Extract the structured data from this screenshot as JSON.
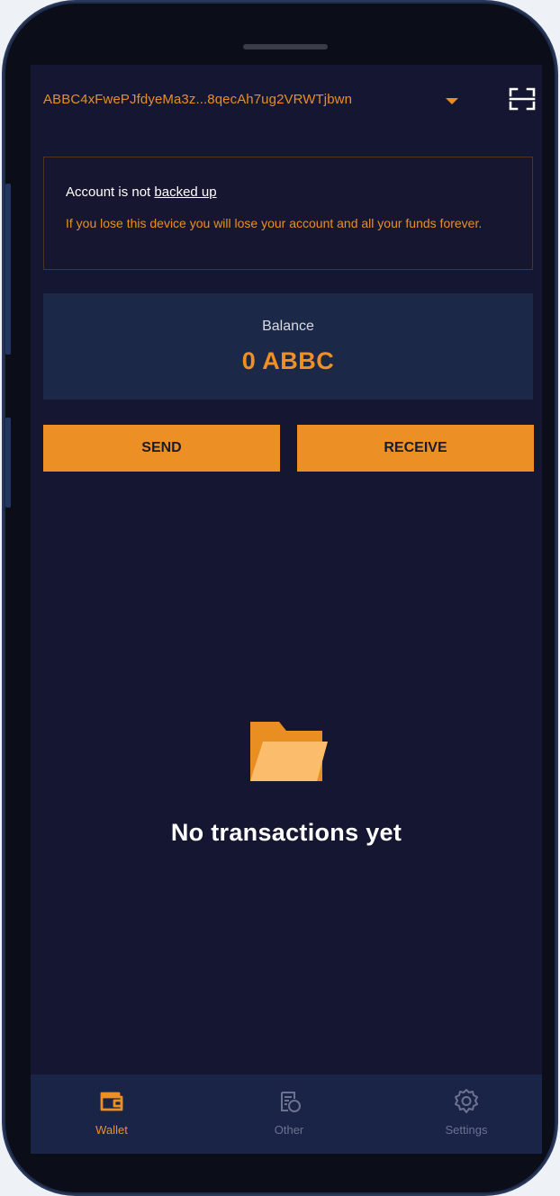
{
  "header": {
    "account_address": "ABBC4xFwePJfdyeMa3z...8qecAh7ug2VRWTjbwn",
    "dropdown_icon": "caret-down-icon",
    "scan_icon": "qr-scan-icon"
  },
  "warning": {
    "title_prefix": "Account is not ",
    "title_link": "backed up",
    "body": "If you lose this device you will lose your account and all your funds forever."
  },
  "balance": {
    "label": "Balance",
    "value": "0 ABBC"
  },
  "actions": {
    "send_label": "SEND",
    "receive_label": "RECEIVE"
  },
  "empty_state": {
    "icon": "folder-open-icon",
    "message": "No transactions yet"
  },
  "nav": {
    "items": [
      {
        "label": "Wallet",
        "icon": "wallet-icon",
        "active": true
      },
      {
        "label": "Other",
        "icon": "other-icon",
        "active": false
      },
      {
        "label": "Settings",
        "icon": "gear-icon",
        "active": false
      }
    ]
  },
  "colors": {
    "accent": "#ec9026",
    "background": "#141632",
    "card": "#1c2848",
    "nav_background": "#1a2446",
    "inactive": "#6a7390"
  }
}
